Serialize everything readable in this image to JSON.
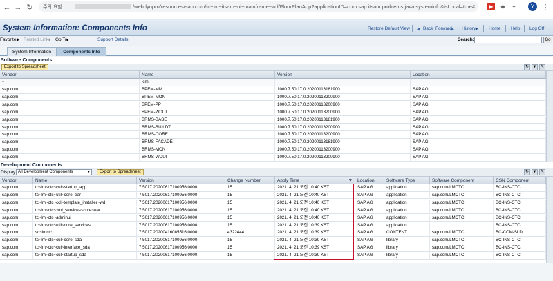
{
  "browser": {
    "info_label": "주의 요함",
    "url_path": "/webdynpro/resources/sap.com/tc~lm~itsam~ui~mainframe~wd/FloorPlanApp?applicationID=com.sap.itsam.problems.java.systeminfo&isLocal=true#",
    "avatar_letter": "Y"
  },
  "header": {
    "title": "System Information: Components Info",
    "restore_default_view": "Restore Default View",
    "back": "Back",
    "forward": "Forward",
    "history": "History",
    "home": "Home",
    "help": "Help",
    "log_off": "Log Off"
  },
  "menu": {
    "favorites": "Favorites",
    "related_links": "Related Links",
    "go_to": "Go To",
    "support_details": "Support Details",
    "search_label": "Search:",
    "go": "Go"
  },
  "tabs": [
    "System Information",
    "Components Info"
  ],
  "software": {
    "title": "Software Components",
    "export_label": "Export to Spreadsheet",
    "columns": [
      "Vendor",
      "Name",
      "Version",
      "Location"
    ],
    "filter_name": "icm",
    "rows": [
      [
        "sap.com",
        "BPEM-MM",
        "1000.7.50.17.0.20200113181900",
        "SAP AG"
      ],
      [
        "sap.com",
        "BPEM-MON",
        "1000.7.50.17.0.20200113200900",
        "SAP AG"
      ],
      [
        "sap.com",
        "BPEM-PP",
        "1000.7.50.17.0.20200113200900",
        "SAP AG"
      ],
      [
        "sap.com",
        "BPEM-WDUI",
        "1000.7.50.17.0.20200113200900",
        "SAP AG"
      ],
      [
        "sap.com",
        "BRMS-BASE",
        "1000.7.50.17.0.20200113181900",
        "SAP AG"
      ],
      [
        "sap.com",
        "BRMS-BUILDT",
        "1000.7.50.17.0.20200113200900",
        "SAP AG"
      ],
      [
        "sap.com",
        "BRMS-CORE",
        "1000.7.50.17.0.20200113200900",
        "SAP AG"
      ],
      [
        "sap.com",
        "BRMS-FACADE",
        "1000.7.50.17.0.20200113181900",
        "SAP AG"
      ],
      [
        "sap.com",
        "BRMS-MON",
        "1000.7.50.17.0.20200113200900",
        "SAP AG"
      ],
      [
        "sap.com",
        "BRMS-WDUI",
        "1000.7.50.17.0.20200113200900",
        "SAP AG"
      ]
    ]
  },
  "development": {
    "title": "Development Components",
    "display_label": "Display:",
    "display_value": "All Development Components",
    "export_label": "Export to Spreadsheet",
    "columns": [
      "Vendor",
      "Name",
      "Version",
      "Change Number",
      "Apply Time",
      "Location",
      "Software Type",
      "Software Component",
      "CSN Component"
    ],
    "rows": [
      [
        "sap.com",
        "tc~lm~ctc~cul~startup_app",
        "7.5017.20200617100956.0000",
        "15",
        "2021. 4. 21 오전 10:40 KST",
        "SAP AG",
        "application",
        "sap.com/LMCTC",
        "BC-INS-CTC"
      ],
      [
        "sap.com",
        "tc~lm~ctc~util~core_ear",
        "7.5017.20200617100956.0000",
        "15",
        "2021. 4. 21 오전 10:40 KST",
        "SAP AG",
        "application",
        "sap.com/LMCTC",
        "BC-INS-CTC"
      ],
      [
        "sap.com",
        "tc~lm~ctc~ccl~template_installer~wd",
        "7.5017.20200617100956.0000",
        "15",
        "2021. 4. 21 오전 10:40 KST",
        "SAP AG",
        "application",
        "sap.com/LMCTC",
        "BC-INS-CTC"
      ],
      [
        "sap.com",
        "tc~lm~ctc~xml_services~core~ear",
        "7.5017.20200617100956.0000",
        "15",
        "2021. 4. 21 오전 10:40 KST",
        "SAP AG",
        "application",
        "sap.com/LMCTC",
        "BC-INS-CTC"
      ],
      [
        "sap.com",
        "tc~lm~ctc~adminui",
        "7.5017.20200617100956.0000",
        "15",
        "2021. 4. 21 오전 10:40 KST",
        "SAP AG",
        "application",
        "sap.com/LMCTC",
        "BC-INS-CTC"
      ],
      [
        "sap.com",
        "tc~lm~ctc~util~core_services",
        "7.5017.20200617100956.0000",
        "15",
        "2021. 4. 21 오전 10:39 KST",
        "SAP AG",
        "application",
        "",
        "BC-INS-CTC"
      ],
      [
        "sap.com",
        "sc~lmctc",
        "7.5017.20200416085516.0000",
        "4322444",
        "2021. 4. 21 오전 10:39 KST",
        "SAP AG",
        "CONTENT",
        "sap.com/LMCTC",
        "BC-CCM-SLD"
      ],
      [
        "sap.com",
        "tc~lm~ctc~cul~core_sda",
        "7.5017.20200617100956.0000",
        "15",
        "2021. 4. 21 오전 10:39 KST",
        "SAP AG",
        "library",
        "sap.com/LMCTC",
        "BC-INS-CTC"
      ],
      [
        "sap.com",
        "tc~lm~ctc~cul~interface_sda",
        "7.5017.20200617100956.0000",
        "15",
        "2021. 4. 21 오전 10:39 KST",
        "SAP AG",
        "library",
        "sap.com/LMCTC",
        "BC-INS-CTC"
      ],
      [
        "sap.com",
        "tc~lm~ctc~cul~startup_sda",
        "7.5017.20200617100956.0000",
        "15",
        "2021. 4. 21 오전 10:39 KST",
        "SAP AG",
        "library",
        "sap.com/LMCTC",
        "BC-INS-CTC"
      ]
    ]
  },
  "colors": {
    "accent": "#15376a",
    "highlight": "#c8102e",
    "button": "#fae8a6"
  }
}
